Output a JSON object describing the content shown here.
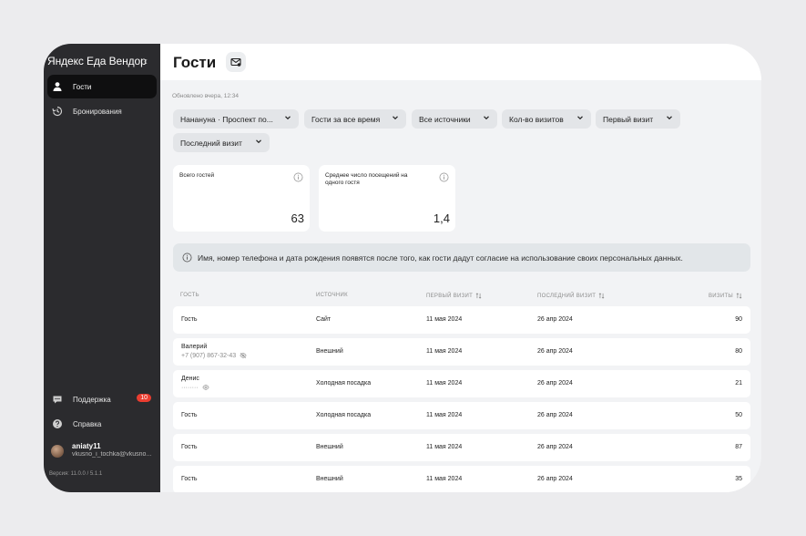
{
  "sidebar": {
    "brand": "Яндекс Еда Вендор",
    "collapse_icon": "chevron-left-icon",
    "items": [
      {
        "label": "Гости",
        "icon": "person-icon",
        "active": true
      },
      {
        "label": "Бронирования",
        "icon": "history-icon",
        "active": false
      }
    ],
    "bottom_items": [
      {
        "label": "Поддержка",
        "icon": "chat-icon",
        "badge": "10"
      },
      {
        "label": "Справка",
        "icon": "help-icon"
      }
    ],
    "user": {
      "name": "aniaty11",
      "email": "vkusno_i_tochka@vkusno..."
    },
    "version": "Версия: 11.0.0 / 5.1.1"
  },
  "header": {
    "title": "Гости",
    "mail_icon": "mail-settings-icon"
  },
  "updated": "Обновлено вчера, 12:34",
  "filters": [
    {
      "label": "Нанануна · Проспект по..."
    },
    {
      "label": "Гости за все время"
    },
    {
      "label": "Все источники"
    },
    {
      "label": "Кол-во визитов"
    },
    {
      "label": "Первый визит"
    },
    {
      "label": "Последний визит"
    }
  ],
  "stats": [
    {
      "label": "Всего гостей",
      "value": "63"
    },
    {
      "label": "Среднее число посещений на одного гостя",
      "value": "1,4"
    }
  ],
  "notice": "Имя, номер телефона и дата рождения появятся после того, как гости дадут согласие на использование своих персональных данных.",
  "table": {
    "headers": [
      "ГОСТЬ",
      "ИСТОЧНИК",
      "ПЕРВЫЙ ВИЗИТ",
      "ПОСЛЕДНИЙ ВИЗИТ",
      "ВИЗИТЫ"
    ],
    "rows": [
      {
        "guest": "Гость",
        "sub": "",
        "source": "Сайт",
        "first": "11 мая 2024",
        "last": "26 апр 2024",
        "visits": "90"
      },
      {
        "guest": "Валерий",
        "sub": "+7 (907) 867-32-43",
        "source": "Внешний",
        "first": "11 мая 2024",
        "last": "26 апр 2024",
        "visits": "80"
      },
      {
        "guest": "Денис",
        "sub": "········",
        "source": "Холодная посадка",
        "first": "11 мая 2024",
        "last": "26 апр 2024",
        "visits": "21"
      },
      {
        "guest": "Гость",
        "sub": "",
        "source": "Холодная посадка",
        "first": "11 мая 2024",
        "last": "26 апр 2024",
        "visits": "50"
      },
      {
        "guest": "Гость",
        "sub": "",
        "source": "Внешний",
        "first": "11 мая 2024",
        "last": "26 апр 2024",
        "visits": "87"
      },
      {
        "guest": "Гость",
        "sub": "",
        "source": "Внешний",
        "first": "11 мая 2024",
        "last": "26 апр 2024",
        "visits": "35"
      }
    ]
  }
}
